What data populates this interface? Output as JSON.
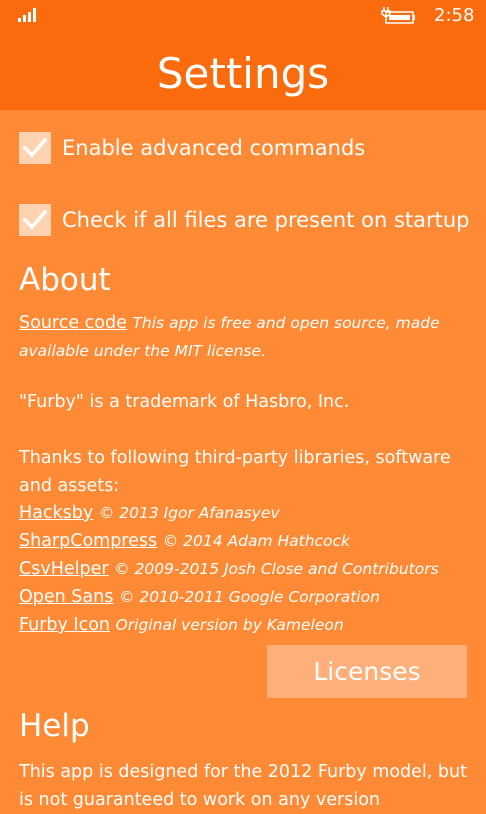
{
  "status_bar": {
    "signal_icon": "signal-strength-icon",
    "battery_icon": "battery-charging-icon",
    "time": "2:58"
  },
  "header": {
    "title": "Settings"
  },
  "options": [
    {
      "label": "Enable advanced commands",
      "checked": true
    },
    {
      "label": "Check if all files are present on startup",
      "checked": true
    }
  ],
  "about": {
    "heading": "About",
    "source_link": "Source code",
    "source_note": "This app is free and open source, made available under the MIT license.",
    "trademark": "\"Furby\" is a trademark of Hasbro, Inc.",
    "thanks": "Thanks to following third-party libraries, software and assets:",
    "credits": [
      {
        "name": "Hacksby",
        "note": "© 2013 Igor Afanasyev"
      },
      {
        "name": "SharpCompress",
        "note": "© 2014 Adam Hathcock"
      },
      {
        "name": "CsvHelper",
        "note": "© 2009-2015 Josh Close and Contributors"
      },
      {
        "name": "Open Sans",
        "note": "© 2010-2011 Google Corporation"
      },
      {
        "name": "Furby Icon",
        "note": "Original version by Kameleon"
      }
    ],
    "licenses_button": "Licenses"
  },
  "help": {
    "heading": "Help",
    "text": "This app is designed for the 2012 Furby model, but is not guaranteed to work on any version"
  },
  "colors": {
    "background": "#FF8A35",
    "header": "#F96B0C",
    "checkbox": "#FFD2B1",
    "button": "#FFB07A",
    "text": "#FFFFFF"
  }
}
